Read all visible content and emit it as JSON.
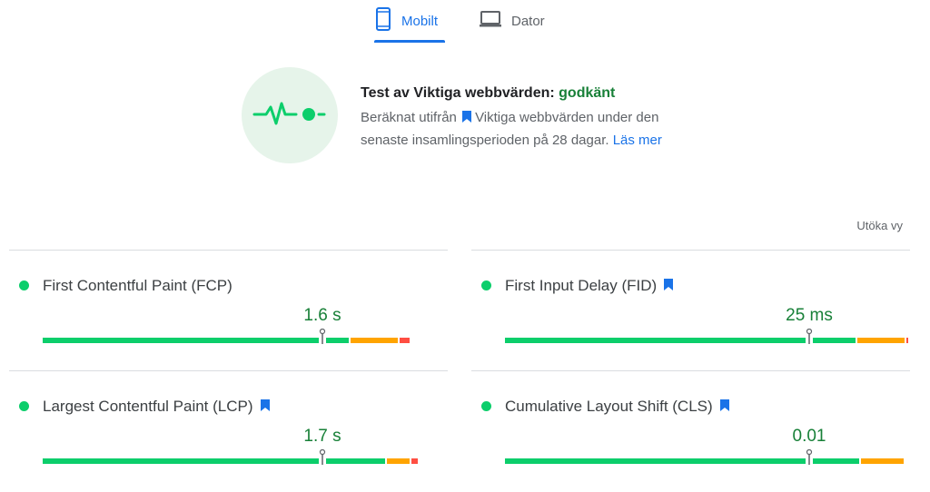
{
  "tabs": [
    {
      "label": "Mobilt",
      "icon": "phone-icon",
      "selected": true
    },
    {
      "label": "Dator",
      "icon": "laptop-icon",
      "selected": false
    }
  ],
  "assessment": {
    "title": "Test av Viktiga webbvärden:",
    "status": "godkänt",
    "desc_prefix": "Beräknat utifrån",
    "desc_bookmark_icon": "bookmark-icon",
    "desc_suffix": "Viktiga webbvärden under den senaste insamlingsperioden på 28 dagar.",
    "link": "Läs mer",
    "icon": "pulse-icon"
  },
  "expand_label": "Utöka vy",
  "colors": {
    "accent": "#1a73e8",
    "good": "#0cce6b",
    "good_text": "#188038",
    "needs_improvement": "#ffa400",
    "poor": "#ff4e42"
  },
  "metrics": [
    {
      "name": "First Contentful Paint (FCP)",
      "value": "1.6 s",
      "core": false,
      "distribution": {
        "good": 0.76,
        "needs_improvement": 0.12,
        "poor": 0.03
      },
      "marker": 0.69
    },
    {
      "name": "First Input Delay (FID)",
      "value": "25 ms",
      "core": true,
      "distribution": {
        "good": 0.87,
        "needs_improvement": 0.12,
        "poor": 0.01
      },
      "marker": 0.75
    },
    {
      "name": "Largest Contentful Paint (LCP)",
      "value": "1.7 s",
      "core": true,
      "distribution": {
        "good": 0.85,
        "needs_improvement": 0.06,
        "poor": 0.02
      },
      "marker": 0.69
    },
    {
      "name": "Cumulative Layout Shift (CLS)",
      "value": "0.01",
      "core": true,
      "distribution": {
        "good": 0.88,
        "needs_improvement": 0.11,
        "poor": 0.0
      },
      "marker": 0.75
    }
  ]
}
